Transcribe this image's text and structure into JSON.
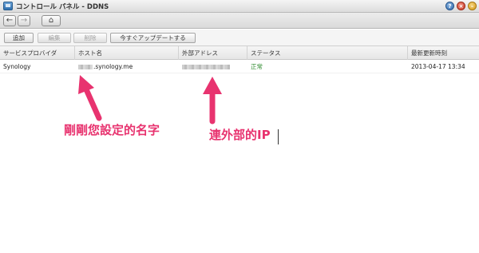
{
  "window": {
    "title": "コントロール パネル - DDNS",
    "icons": [
      "control-panel-icon",
      "help-icon",
      "close-icon",
      "minimize-icon"
    ]
  },
  "nav": {
    "back": "←",
    "forward": "→",
    "home": "⌂"
  },
  "toolbar": {
    "add_label": "追加",
    "edit_label": "編集",
    "delete_label": "削除",
    "update_label": "今すぐアップデートする"
  },
  "table": {
    "columns": [
      "サービスプロバイダ",
      "ホスト名",
      "外部アドレス",
      "ステータス",
      "最新更新時刻"
    ],
    "rows": [
      {
        "provider": "Synology",
        "hostname_suffix": ".synology.me",
        "status": "正常",
        "last_updated": "2013-04-17 13:34"
      }
    ]
  },
  "annotations": {
    "hostname_note": "剛剛您設定的名字",
    "ip_note": "連外部的IP"
  },
  "colors": {
    "annotation": "#e8336f",
    "status_ok": "#2e8b2e"
  }
}
